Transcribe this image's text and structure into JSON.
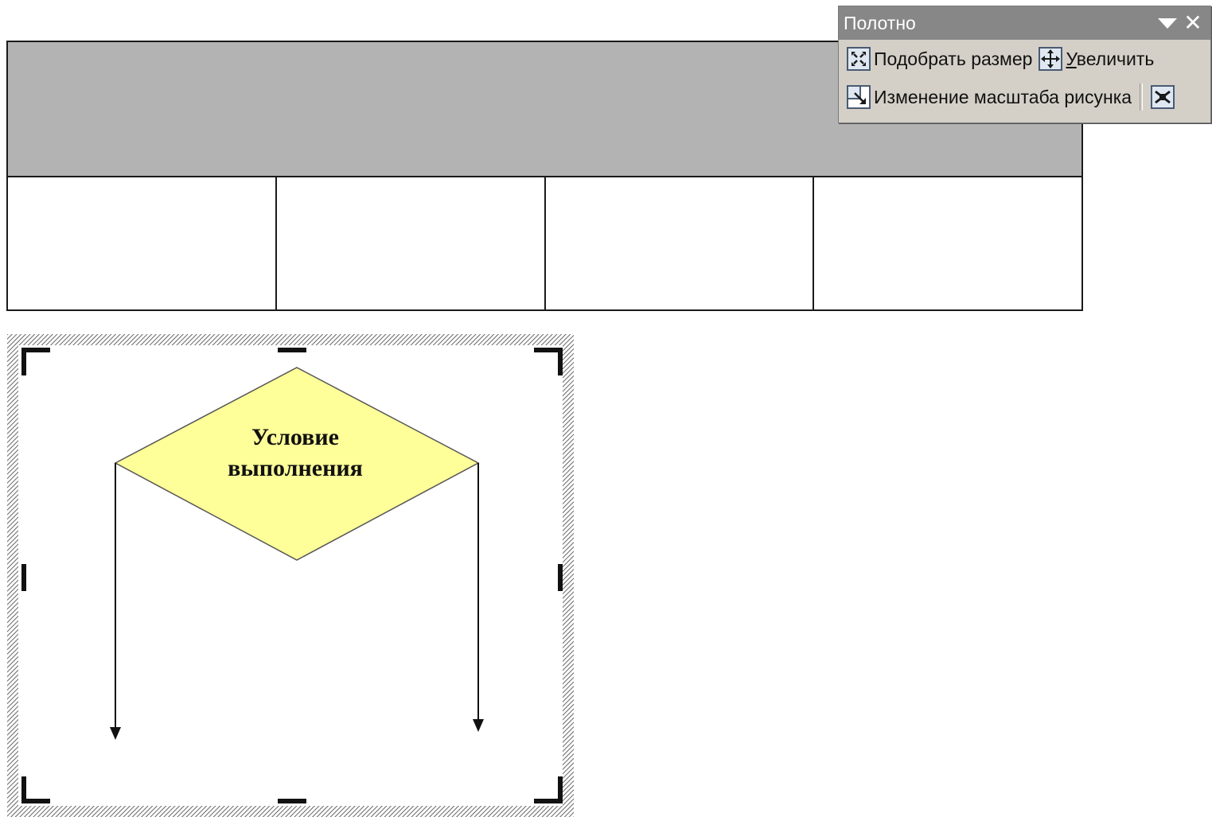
{
  "toolbar": {
    "title": "Полотно",
    "menu_icon": "chevron-down-icon",
    "close_icon": "close-icon",
    "fit_label": "Подобрать размер",
    "expand_label_mnemonic": "У",
    "expand_label_rest": "величить",
    "scale_label": "Изменение масштаба рисунка",
    "text_wrap_icon": "text-wrap-icon"
  },
  "table": {
    "header_color": "#b3b3b3",
    "columns": [
      "",
      "",
      "",
      ""
    ]
  },
  "canvas": {
    "decision_text_line1": "Условие",
    "decision_text_line2": "выполнения",
    "decision_fill": "#ffff99"
  }
}
